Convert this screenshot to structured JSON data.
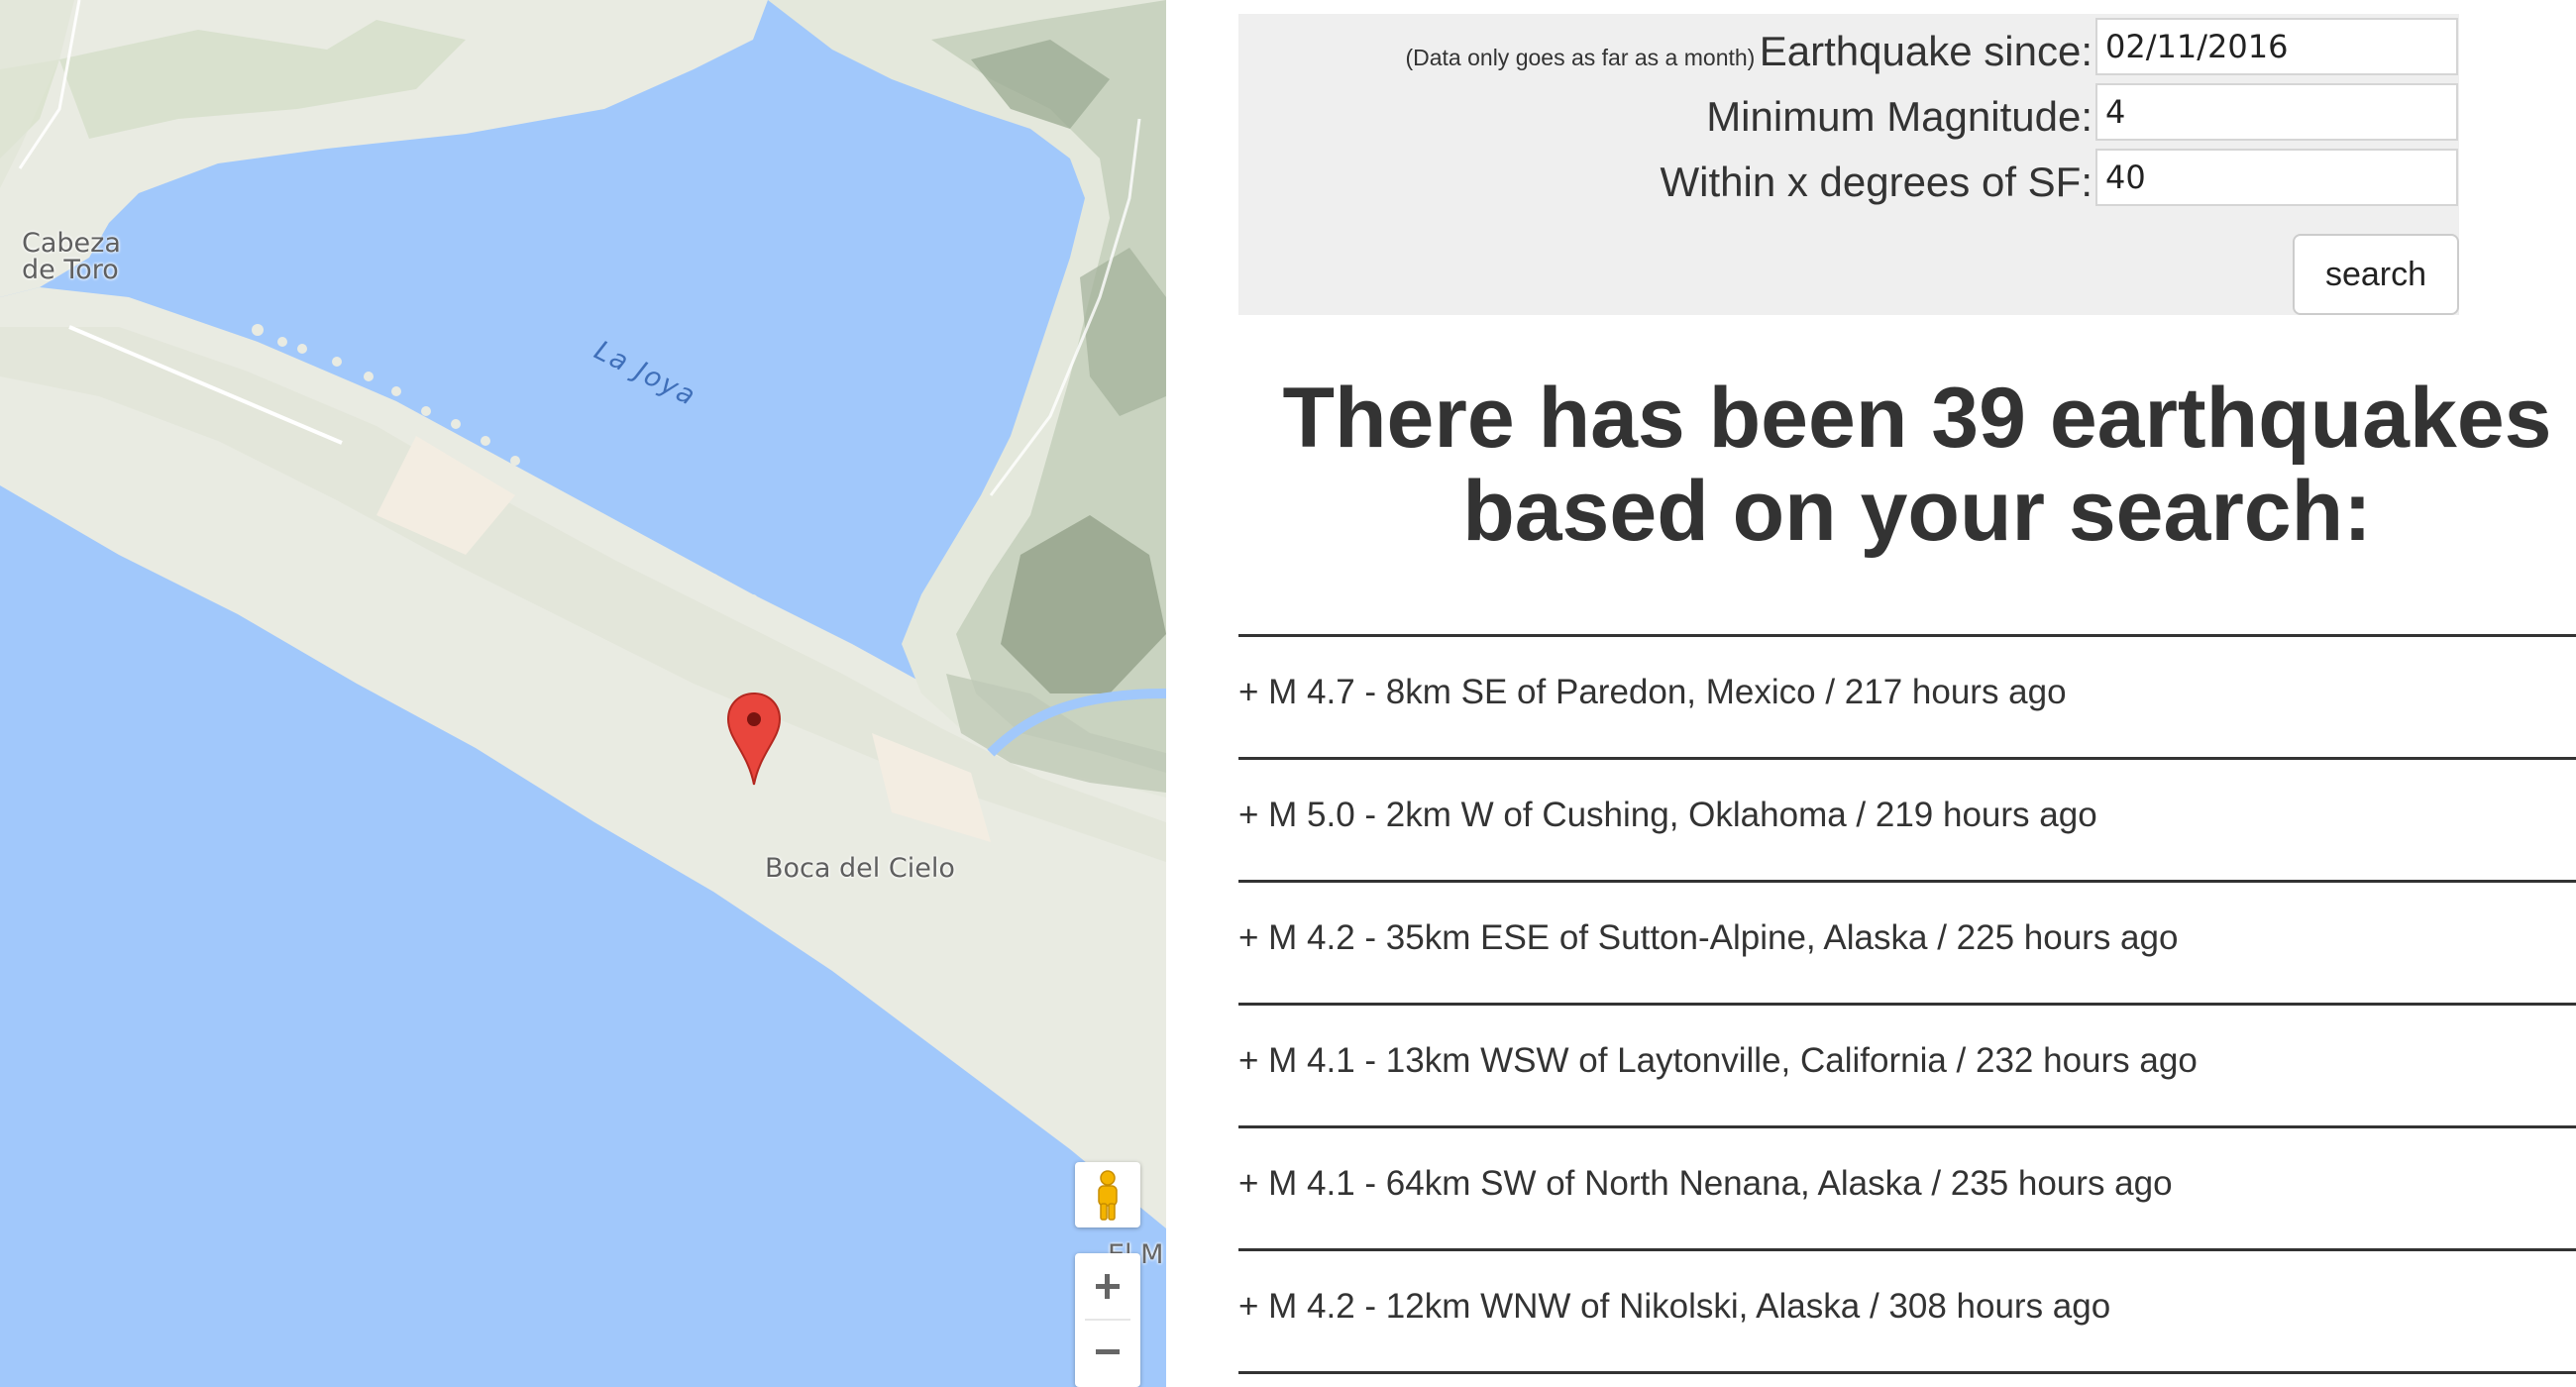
{
  "map": {
    "labels": {
      "cabeza": "Cabeza\nde Toro",
      "la_joya": "La Joya",
      "boca": "Boca del Cielo",
      "partial": "El M"
    },
    "controls": {
      "zoom_in": "+",
      "zoom_out": "−"
    },
    "colors": {
      "water": "#a1c8fb",
      "land": "#e9ebe2",
      "terrain": "#c9d3c0",
      "marker": "#e8453c"
    }
  },
  "form": {
    "since_note": "(Data only goes as far as a month)",
    "since_label": "Earthquake since:",
    "since_value": "02/11/2016",
    "magnitude_label": "Minimum Magnitude:",
    "magnitude_value": "4",
    "degrees_label": "Within x degrees of SF:",
    "degrees_value": "40",
    "search_button": "search"
  },
  "heading": {
    "line1": "There has been 39 earthquakes",
    "line2": "based on your search:"
  },
  "results": [
    "+ M 4.7 - 8km SE of Paredon, Mexico / 217 hours ago",
    "+ M 5.0 - 2km W of Cushing, Oklahoma / 219 hours ago",
    "+ M 4.2 - 35km ESE of Sutton-Alpine, Alaska / 225 hours ago",
    "+ M 4.1 - 13km WSW of Laytonville, California / 232 hours ago",
    "+ M 4.1 - 64km SW of North Nenana, Alaska / 235 hours ago",
    "+ M 4.2 - 12km WNW of Nikolski, Alaska / 308 hours ago"
  ]
}
